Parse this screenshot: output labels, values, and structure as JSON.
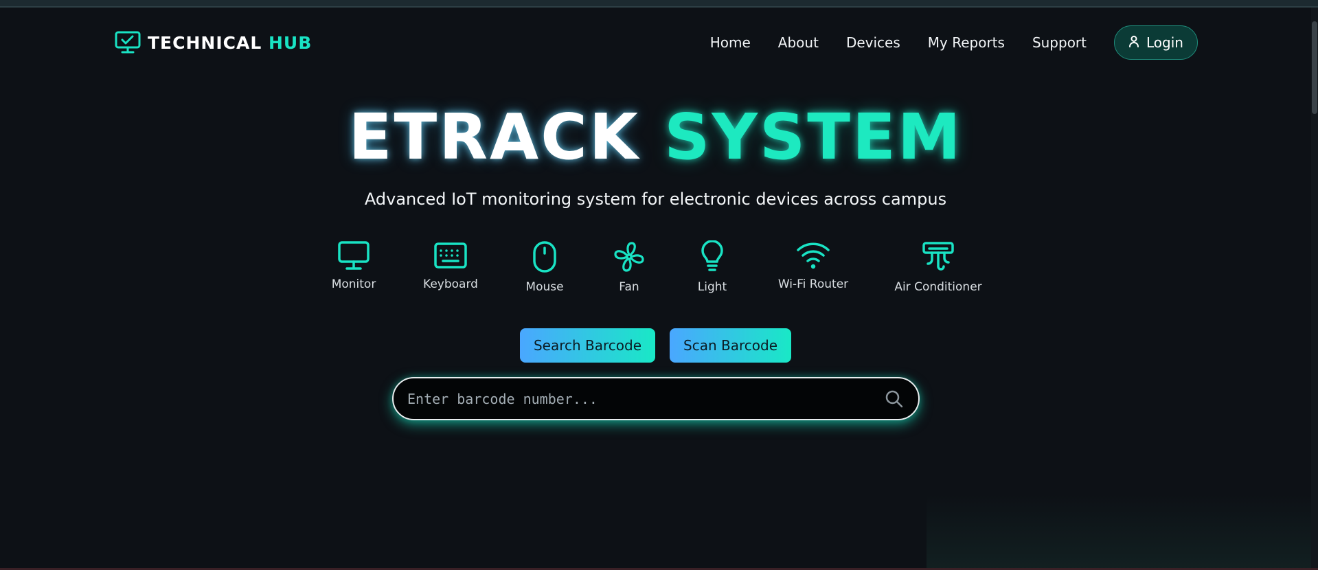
{
  "brand": {
    "name_white": "TECHNICAL",
    "name_accent": "HUB",
    "icon": "monitor-check-icon"
  },
  "nav": {
    "items": [
      {
        "label": "Home"
      },
      {
        "label": "About"
      },
      {
        "label": "Devices"
      },
      {
        "label": "My Reports"
      },
      {
        "label": "Support"
      }
    ],
    "login_label": "Login",
    "login_icon": "user-icon"
  },
  "hero": {
    "title_white": "ETRACK",
    "title_accent": "SYSTEM",
    "subtitle": "Advanced IoT monitoring system for electronic devices across campus"
  },
  "devices": [
    {
      "label": "Monitor",
      "icon": "monitor-icon"
    },
    {
      "label": "Keyboard",
      "icon": "keyboard-icon"
    },
    {
      "label": "Mouse",
      "icon": "mouse-icon"
    },
    {
      "label": "Fan",
      "icon": "fan-icon"
    },
    {
      "label": "Light",
      "icon": "lightbulb-icon"
    },
    {
      "label": "Wi-Fi Router",
      "icon": "wifi-icon"
    },
    {
      "label": "Air Conditioner",
      "icon": "air-conditioner-icon"
    }
  ],
  "actions": {
    "search_barcode": "Search Barcode",
    "scan_barcode": "Scan Barcode"
  },
  "search": {
    "value": "",
    "placeholder": "Enter barcode number...",
    "icon": "search-icon"
  },
  "colors": {
    "background": "#0d1116",
    "accent": "#19e3c4",
    "button_gradient_start": "#4aa7ff",
    "button_gradient_end": "#19e8c6",
    "login_bg": "#0b3b36"
  }
}
